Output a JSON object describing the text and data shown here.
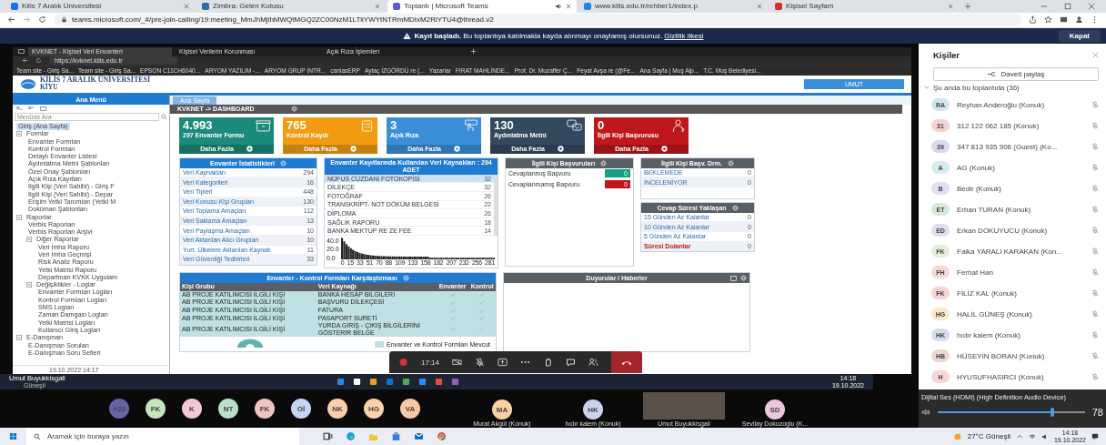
{
  "browser": {
    "tabs": [
      {
        "title": "Kilis 7 Aralık Üniversitesi",
        "selected": false,
        "audio": false,
        "color": "#1a73e8"
      },
      {
        "title": "Zimbra: Gelen Kutusu",
        "selected": false,
        "audio": false,
        "color": "#2b6cb0"
      },
      {
        "title": "Toplantı | Microsoft Teams",
        "selected": true,
        "audio": true,
        "color": "#5b5fc7"
      },
      {
        "title": "www.kilis.edu.tr/rehber1/index.p",
        "selected": false,
        "audio": false,
        "color": "#1e88e5"
      },
      {
        "title": "Kişisel Sayfam",
        "selected": false,
        "audio": false,
        "color": "#d32f2f"
      }
    ],
    "address": "teams.microsoft.com/_#/pre-join-calling/19:meeting_MmJhMjlhMWQtMGQ2ZC00NzM1LTliYWYtNTRmMDIxM2RiYTU4@thread.v2"
  },
  "banner": {
    "lead": "Kayıt başladı.",
    "text": "Bu toplantıya katılmakla kayda alınmayı onaylamış olursunuz.",
    "link": "Gizlilik ilkesi",
    "button": "Kapat"
  },
  "shared_screen": {
    "tabs": [
      {
        "title": "KVKNET - Kişisel Veri Envanteri",
        "selected": true
      },
      {
        "title": "Kişisel Verilerin Korunması",
        "selected": false
      },
      {
        "title": "Açık Rıza İşlemleri",
        "selected": false
      }
    ],
    "address": "https://kvknet.kilis.edu.tr",
    "bookmarks": [
      "Team site - Giriş Sa...",
      "Team site - Giriş Sa...",
      "EPSON C11CH6040...",
      "ARYOM YAZILIM -...",
      "ARYOM GRUP INTR...",
      "caniasERP",
      "Aytaç İZGÖRDÜ re (...",
      "Yazarlar",
      "FIRAT MAHLİNDE...",
      "Prof. Dr. Muzaffer Ç...",
      "Feyat Avşa re (@Fe...",
      "Ana Sayfa | Muş Alp...",
      "T.C. Muş Belediyesi..."
    ],
    "org_name": "KİLİS 7 ARALIK ÜNİVERSİTESİ",
    "org_short": "KİYU",
    "user_button": "UMUT",
    "menu": {
      "title": "Ana Menü",
      "search_placeholder": "Menüde Ara",
      "footer": "19.10.2022 14:17",
      "tree": [
        {
          "label": "Giriş (Ana Sayfa)",
          "selected": true
        },
        {
          "label": "Formlar",
          "selected": false,
          "expanded": true,
          "children": [
            {
              "label": "Envanter Formları",
              "selected": false
            },
            {
              "label": "Kontrol Formları",
              "selected": false
            },
            {
              "label": "Detaylı Envanter Listesi",
              "selected": false
            },
            {
              "label": "Aydınlatma Metni Şablonları",
              "selected": false
            },
            {
              "label": "Özel Onay Şablonları",
              "selected": false
            },
            {
              "label": "Açık Rıza Kayıtları",
              "selected": false
            },
            {
              "label": "İlgili Kişi (Veri Sahibi) - Giriş F",
              "selected": false
            },
            {
              "label": "İlgili Kişi (Veri Sahibi) - Depar",
              "selected": false
            },
            {
              "label": "Erişim Yetki Tanımları (Yetki M",
              "selected": false
            },
            {
              "label": "Doküman Şablonları",
              "selected": false
            }
          ]
        },
        {
          "label": "Raporlar",
          "selected": false,
          "expanded": true,
          "children": [
            {
              "label": "Verbis Raporları",
              "selected": false
            },
            {
              "label": "Verbis Raporları Arşivi",
              "selected": false
            },
            {
              "label": "Diğer Raporlar",
              "selected": false,
              "expanded": true,
              "children": [
                {
                  "label": "Veri İmha Raporu",
                  "selected": false
                },
                {
                  "label": "Veri İmha Geçmişi",
                  "selected": false
                },
                {
                  "label": "Risk Analiz Raporu",
                  "selected": false
                },
                {
                  "label": "Yetki Matrisi Raporu",
                  "selected": false
                },
                {
                  "label": "Departman KVKK Uygulam",
                  "selected": false
                }
              ]
            },
            {
              "label": "Değişiklikler - Loglar",
              "selected": false,
              "expanded": true,
              "children": [
                {
                  "label": "Envanter Formları Logları",
                  "selected": false
                },
                {
                  "label": "Kontrol Formları Logları",
                  "selected": false
                },
                {
                  "label": "SMS Logları",
                  "selected": false
                },
                {
                  "label": "Zaman Damgası Logları",
                  "selected": false
                },
                {
                  "label": "Yetki Matrisi Logları",
                  "selected": false
                },
                {
                  "label": "Kullanıcı Giriş Logları",
                  "selected": false
                }
              ]
            }
          ]
        },
        {
          "label": "E-Danışman",
          "selected": false,
          "expanded": true,
          "children": [
            {
              "label": "E-Danışman Soruları",
              "selected": false
            },
            {
              "label": "E-Danışman Soru Setleri",
              "selected": false
            }
          ]
        }
      ]
    },
    "page_tab": "Ana Sayfa",
    "breadcrumb": "KVKNET -> DASHBOARD",
    "tiles": [
      {
        "value": "4.993",
        "label": "297 Envanter Formu",
        "more": "Daha Fazla",
        "color": "#1b8a7a",
        "kind": "box"
      },
      {
        "value": "765",
        "label": "Kontrol Kaydı",
        "more": "Daha Fazla",
        "color": "#f39c12",
        "kind": "checklist"
      },
      {
        "value": "3",
        "label": "Açık Rıza",
        "more": "Daha Fazla",
        "color": "#3a8fd8",
        "kind": "hand"
      },
      {
        "value": "130",
        "label": "Aydınlatma Metni",
        "more": "Daha Fazla",
        "color": "#34495e",
        "kind": "chat"
      },
      {
        "value": "0",
        "label": "İlgili Kişi Başvurusu",
        "more": "Daha Fazla",
        "color": "#c0171b",
        "kind": "person"
      }
    ],
    "stats_panel": {
      "title": "Envanter İstatistikleri",
      "rows": [
        {
          "label": "Veri Kaynakları",
          "count": "294"
        },
        {
          "label": "Veri Kategorileri",
          "count": "16"
        },
        {
          "label": "Veri Tipleri",
          "count": "448"
        },
        {
          "label": "Veri Konusu Kişi Grupları",
          "count": "130"
        },
        {
          "label": "Veri Toplama Amaçları",
          "count": "112"
        },
        {
          "label": "Veri Saklama Amaçları",
          "count": "13"
        },
        {
          "label": "Veri Paylaşma Amaçları",
          "count": "10"
        },
        {
          "label": "Veri Aktarılan Alıcı Grupları",
          "count": "10"
        },
        {
          "label": "Yurt. Ülkelere Aktarılan Kaynak",
          "count": "11"
        },
        {
          "label": "Veri Güvenliği Tedbirleri",
          "count": "33"
        }
      ]
    },
    "sources_panel": {
      "title": "Envanter Kayıtlarında Kullanılan Veri Kaynakları : 294 ADET",
      "rows": [
        {
          "label": "NÜFUS CÜZDANI FOTOKOPİSİ",
          "count": "32",
          "selected": true
        },
        {
          "label": "DİLEKÇE",
          "count": "32",
          "selected": false
        },
        {
          "label": "FOTOĞRAF",
          "count": "26",
          "selected": false
        },
        {
          "label": "TRANSKRİPT- NOT DÖKÜM BELGESİ",
          "count": "22",
          "selected": false
        },
        {
          "label": "DİPLOMA",
          "count": "26",
          "selected": false
        },
        {
          "label": "SAĞLIK RAPORU",
          "count": "18",
          "selected": false
        },
        {
          "label": "BANKA MEKTUP RE ZE FEE",
          "count": "14",
          "selected": false
        }
      ],
      "y_ticks": [
        "40.0",
        "20.0",
        "0.0"
      ],
      "x_ticks": [
        "0",
        "15",
        "33",
        "51",
        "70",
        "88",
        "109",
        "133",
        "158",
        "182",
        "207",
        "232",
        "256",
        "281"
      ]
    },
    "requests_panel": {
      "title": "İlgili Kişi Başvuruları",
      "rows": [
        {
          "label": "Cevaplanmış Başvuru",
          "count": "0",
          "color": "#16a085"
        },
        {
          "label": "Cevaplanmamış Başvuru",
          "count": "0",
          "color": "#c0171b"
        }
      ]
    },
    "status_panel": {
      "title": "İlgili Kişi Başv. Drm.",
      "rows": [
        {
          "label": "BEKLEMEDE",
          "count": "0"
        },
        {
          "label": "İNCELENİYOR",
          "count": "0"
        }
      ]
    },
    "deadline_panel": {
      "title": "Cevap Süresi Yaklaşan",
      "rows": [
        {
          "label": "15 Günden Az Kalanlar",
          "count": "0",
          "alert": false
        },
        {
          "label": "10 Günden Az Kalanlar",
          "count": "0",
          "alert": false
        },
        {
          "label": "5 Günden Az Kalanlar",
          "count": "0",
          "alert": false
        },
        {
          "label": "Süresi Dolanlar",
          "count": "0",
          "alert": true
        }
      ]
    },
    "comparison_panel": {
      "title": "Envanter - Kontrol Formları Karşılaştırması",
      "columns": [
        "Kişi Grubu",
        "Veri Kaynağı",
        "Envanter",
        "Kontrol"
      ],
      "rows": [
        {
          "group": "AB PROJE KATILIMCISI İLGİLİ KİŞİ",
          "source": "BANKA HESAP BİLGİLERİ",
          "inventory": true,
          "control": true
        },
        {
          "group": "AB PROJE KATILIMCISI İLGİLİ KİŞİ",
          "source": "BAŞVURU DİLEKÇESİ",
          "inventory": true,
          "control": true
        },
        {
          "group": "AB PROJE KATILIMCISI İLGİLİ KİŞİ",
          "source": "FATURA",
          "inventory": true,
          "control": true
        },
        {
          "group": "AB PROJE KATILIMCISI İLGİLİ KİŞİ",
          "source": "PASAPORT SURETİ",
          "inventory": true,
          "control": true
        },
        {
          "group": "AB PROJE KATILIMCISI İLGİLİ KİŞİ",
          "source": "YURDA GİRİŞ - ÇIKIŞ BİLGİLERİNİ GÖSTERİR BELGE",
          "inventory": true,
          "control": true
        }
      ],
      "legend": "Envanter ve Kontrol Formları Mevcut"
    },
    "news_panel": {
      "title": "Duyurular / Haberler"
    },
    "taskbar": {
      "user": "Umut Buyukkisgali",
      "weather": "Güneşli",
      "time": "14:18",
      "date": "19.10.2022"
    }
  },
  "call_controls": {
    "timer": "17:14",
    "recording": true
  },
  "participants_panel": {
    "title": "Kişiler",
    "invite_button": "Daveti paylaş",
    "section": "Şu anda bu toplantıda (36)",
    "expanded": true,
    "people": [
      {
        "initials": "RA",
        "name": "Reyhan Anderoğlu (Konuk)",
        "color": "#cfe6ef"
      },
      {
        "initials": "31",
        "name": "312 122 062 185 (Konuk)",
        "color": "#f6d2d2"
      },
      {
        "initials": "39",
        "name": "347 813 935 906 (Guest) (Ko...",
        "color": "#dcd6f0"
      },
      {
        "initials": "A",
        "name": "AG (Konuk)",
        "color": "#d2ecef"
      },
      {
        "initials": "B",
        "name": "Bedir (Konuk)",
        "color": "#e1dff0"
      },
      {
        "initials": "ET",
        "name": "Erhan TURAN (Konuk)",
        "color": "#d6ead6"
      },
      {
        "initials": "ED",
        "name": "Erkan DOKUYUCU (Konuk)",
        "color": "#e0dcf2"
      },
      {
        "initials": "FK",
        "name": "Faika YARALI KARAKAN (Kon...",
        "color": "#e3efda"
      },
      {
        "initials": "FH",
        "name": "Ferhat Han",
        "color": "#f7d8d4"
      },
      {
        "initials": "FK",
        "name": "FİLİZ KAL (Konuk)",
        "color": "#f6d4d4"
      },
      {
        "initials": "HG",
        "name": "HALİL GÜNEŞ (Konuk)",
        "color": "#fce6cc"
      },
      {
        "initials": "HK",
        "name": "hıdır kalem (Konuk)",
        "color": "#d5ddf1"
      },
      {
        "initials": "HB",
        "name": "HÜSEYİN BORAN (Konuk)",
        "color": "#efd8d4"
      },
      {
        "initials": "H",
        "name": "HYUSUFHASIRCI (Konuk)",
        "color": "#f6d6d6"
      }
    ]
  },
  "gallery": {
    "avatars": [
      {
        "initials": "+23",
        "color": "#6264a7"
      },
      {
        "initials": "FK",
        "color": "#c8e3c0"
      },
      {
        "initials": "K",
        "color": "#f4c6d6"
      },
      {
        "initials": "NT",
        "color": "#b9e0c9"
      },
      {
        "initials": "FK",
        "color": "#f3c2c0"
      },
      {
        "initials": "Oİ",
        "color": "#c5d6f2"
      },
      {
        "initials": "NK",
        "color": "#f8cfa9"
      },
      {
        "initials": "HG",
        "color": "#f8d2a8"
      },
      {
        "initials": "VA",
        "color": "#f5c9a6"
      }
    ],
    "tiles": [
      {
        "kind": "avatar",
        "initials": "MA",
        "name": "Murat Akgül (Konuk)",
        "color": "#f8d0a5"
      },
      {
        "kind": "avatar",
        "initials": "HK",
        "name": "hıdır kalem (Konuk)",
        "color": "#c9d3ef"
      },
      {
        "kind": "video",
        "name": "Umut Buyukkisgali"
      },
      {
        "kind": "avatar",
        "initials": "SD",
        "name": "Sevilay Dokuzoglu (K...",
        "color": "#efc6e0"
      }
    ]
  },
  "audio": {
    "device": "Dijital Ses (HDMI) (High Definition Audio Device)",
    "level": 0.78,
    "reading": "78"
  },
  "taskbar": {
    "search_placeholder": "Aramak için buraya yazın",
    "weather": "27°C Güneşli",
    "time": "14:18",
    "date": "19.10.2022"
  }
}
